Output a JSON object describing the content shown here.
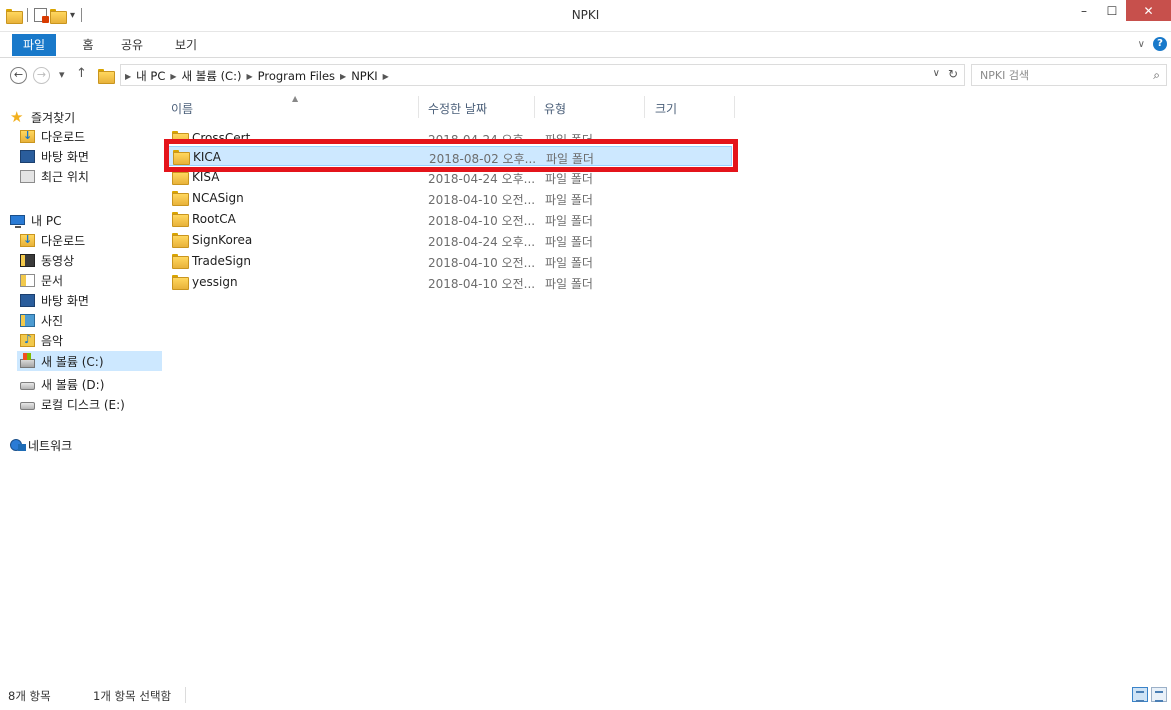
{
  "window": {
    "title": "NPKI"
  },
  "ribbon": {
    "tabs": [
      "파일",
      "홈",
      "공유",
      "보기"
    ]
  },
  "address": {
    "crumbs": [
      "내 PC",
      "새 볼륨 (C:)",
      "Program Files",
      "NPKI"
    ],
    "search_placeholder": "NPKI 검색"
  },
  "nav": {
    "favorites": "즐겨찾기",
    "fav_items": [
      "다운로드",
      "바탕 화면",
      "최근 위치"
    ],
    "this_pc": "내 PC",
    "pc_items": [
      "다운로드",
      "동영상",
      "문서",
      "바탕 화면",
      "사진",
      "음악",
      "새 볼륨 (C:)",
      "새 볼륨 (D:)",
      "로컬 디스크 (E:)"
    ],
    "network": "네트워크"
  },
  "columns": {
    "name": "이름",
    "date": "수정한 날짜",
    "type": "유형",
    "size": "크기"
  },
  "files": [
    {
      "name": "CrossCert",
      "date": "2018-04-24 오후...",
      "type": "파일 폴더",
      "selected": false
    },
    {
      "name": "KICA",
      "date": "2018-08-02 오후...",
      "type": "파일 폴더",
      "selected": true
    },
    {
      "name": "KISA",
      "date": "2018-04-24 오후...",
      "type": "파일 폴더",
      "selected": false
    },
    {
      "name": "NCASign",
      "date": "2018-04-10 오전...",
      "type": "파일 폴더",
      "selected": false
    },
    {
      "name": "RootCA",
      "date": "2018-04-10 오전...",
      "type": "파일 폴더",
      "selected": false
    },
    {
      "name": "SignKorea",
      "date": "2018-04-24 오후...",
      "type": "파일 폴더",
      "selected": false
    },
    {
      "name": "TradeSign",
      "date": "2018-04-10 오전...",
      "type": "파일 폴더",
      "selected": false
    },
    {
      "name": "yessign",
      "date": "2018-04-10 오전...",
      "type": "파일 폴더",
      "selected": false
    }
  ],
  "status": {
    "count": "8개 항목",
    "selected": "1개 항목 선택함"
  },
  "colors": {
    "accent": "#1979ca",
    "selection": "#cde8ff",
    "highlight": "#e4141b"
  }
}
